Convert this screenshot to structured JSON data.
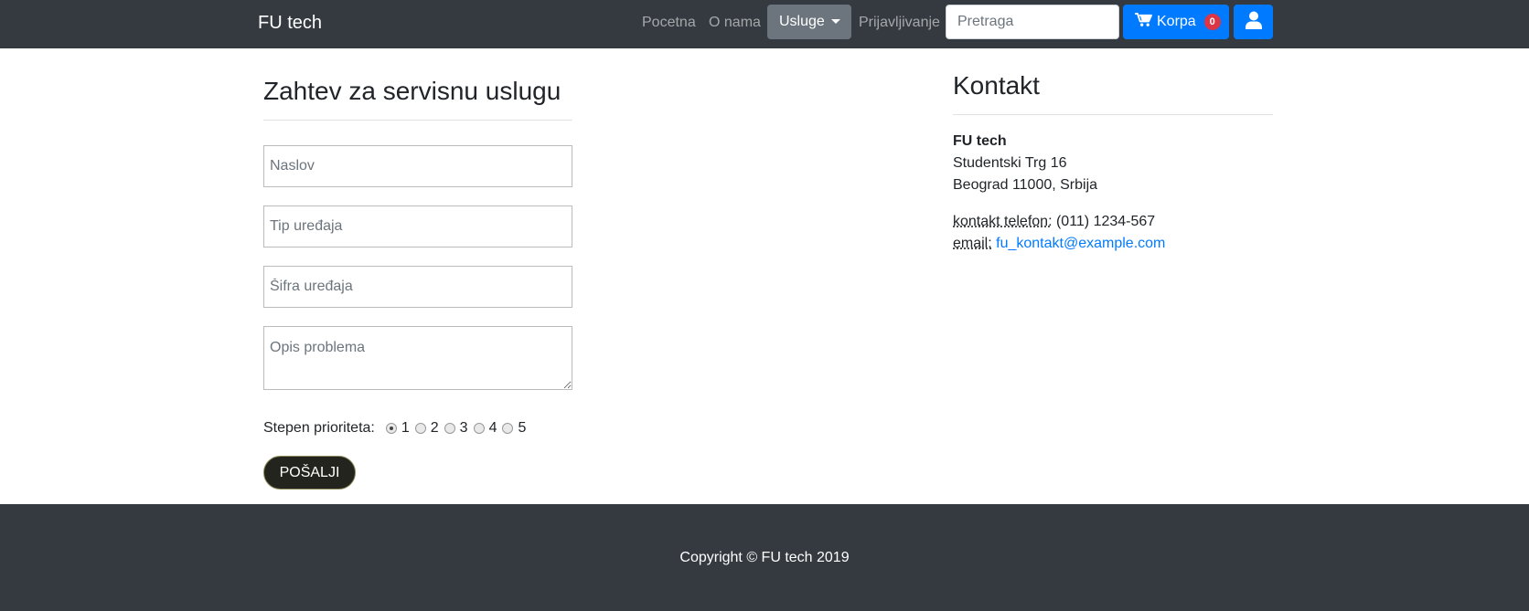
{
  "navbar": {
    "brand": "FU tech",
    "links": [
      "Pocetna",
      "O nama",
      "Usluge",
      "Prijavljivanje"
    ],
    "search": {
      "placeholder": "Pretraga",
      "value": ""
    },
    "cart": {
      "label": "Korpa",
      "count": "0"
    },
    "colors": {
      "background": "#343a40",
      "primary": "#007bff",
      "active": "#6c757d",
      "badge": "#dc3545"
    },
    "icons": [
      "cart-icon",
      "caret-down-icon",
      "user-icon"
    ]
  },
  "form": {
    "title": "Zahtev za servisnu uslugu",
    "fields": {
      "naslov": "Naslov",
      "tip": "Tip uređaja",
      "sifra": "Šifra uređaja",
      "opis": "Opis problema"
    },
    "priority": {
      "label": "Stepen prioriteta:",
      "options": [
        "1",
        "2",
        "3",
        "4",
        "5"
      ],
      "selected": "1"
    },
    "submit_label": "POŠALJI"
  },
  "contact": {
    "title": "Kontakt",
    "company": "FU tech",
    "street": "Studentski Trg 16",
    "city": "Beograd 11000, Srbija",
    "phone_label": "kontakt telefon:",
    "phone": "(011) 1234-567",
    "email_label": "email:",
    "email": "fu_kontakt@example.com"
  },
  "footer": {
    "copyright": "Copyright © FU tech 2019"
  }
}
